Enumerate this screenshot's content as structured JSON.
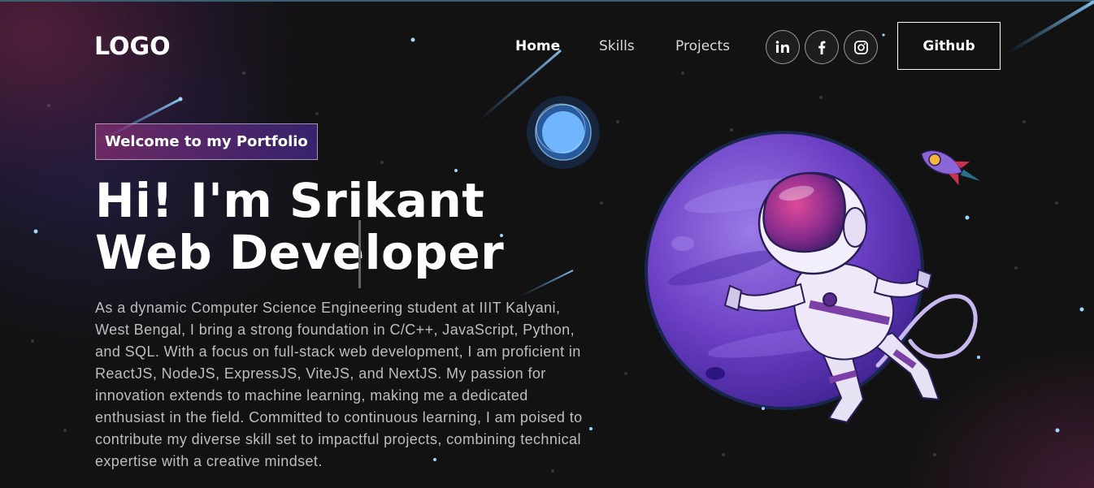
{
  "brand": {
    "logo_text": "LOGO"
  },
  "nav": {
    "links": [
      {
        "label": "Home",
        "active": true
      },
      {
        "label": "Skills",
        "active": false
      },
      {
        "label": "Projects",
        "active": false
      }
    ],
    "social": [
      {
        "icon": "linkedin-icon",
        "label": "in"
      },
      {
        "icon": "facebook-icon",
        "label": "f"
      },
      {
        "icon": "instagram-icon",
        "label": ""
      }
    ],
    "cta_label": "Github"
  },
  "hero": {
    "tagline": "Welcome to my Portfolio",
    "headline": "Hi! I'm Srikant Web Developer",
    "description": "As a dynamic Computer Science Engineering student at IIIT Kalyani, West Bengal, I bring a strong foundation in C/C++, JavaScript, Python, and SQL. With a focus on full-stack web development, I am proficient in ReactJS, NodeJS, ExpressJS, ViteJS, and NextJS. My passion for innovation extends to machine learning, making me a dedicated enthusiast in the field. Committed to continuous learning, I am poised to contribute my diverse skill set to impactful projects, combining technical expertise with a creative mindset."
  },
  "colors": {
    "background": "#121212",
    "tagline_gradient_start": "#aa367c",
    "tagline_gradient_end": "#4a2fbd",
    "planet": "#6b3fc4",
    "text_muted": "#bdbdbd"
  }
}
